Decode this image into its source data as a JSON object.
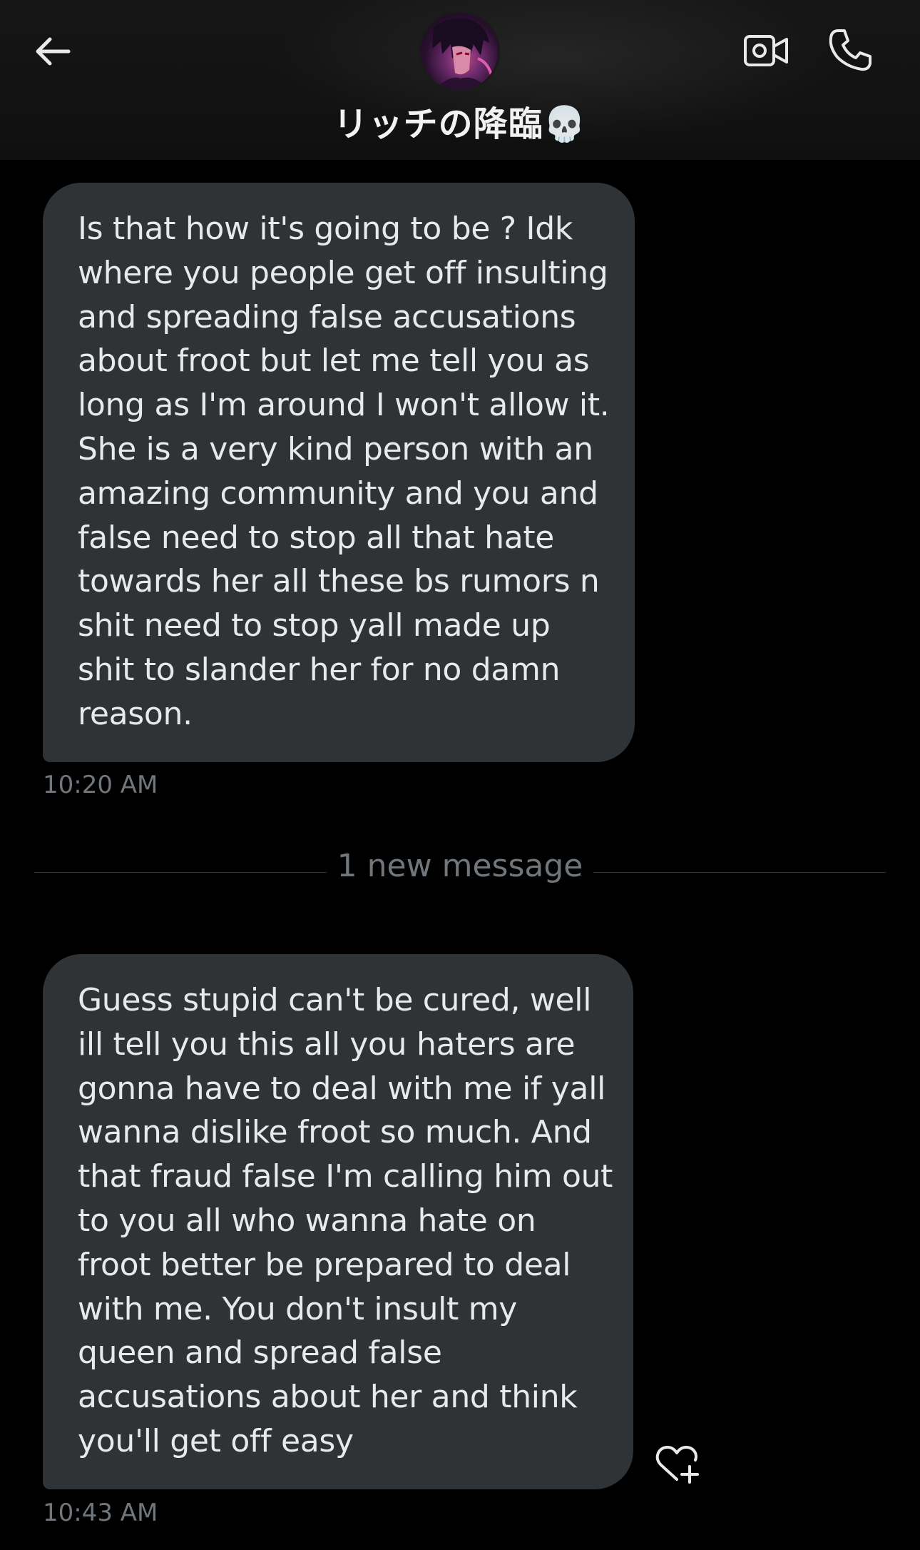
{
  "header": {
    "contact_name": "リッチの降臨💀",
    "back_icon": "arrow-left-icon",
    "video_icon": "video-camera-icon",
    "call_icon": "phone-icon"
  },
  "messages": [
    {
      "lines": [
        "Is that how it's going to be  ? Idk",
        "where you people get off insulting",
        "and spreading false accusations",
        "about froot but let me tell you as",
        "long as I'm around I won't allow it.",
        "She is a very kind person with an",
        "amazing community and you and",
        "false need to stop all that hate",
        "towards her all these bs rumors n",
        "shit need to stop yall made up",
        "shit to slander her for no damn",
        "reason."
      ],
      "timestamp": "10:20 AM"
    },
    {
      "lines": [
        "Guess stupid can't be cured, well",
        "ill tell you this all you haters are",
        "gonna have to deal with me if yall",
        "wanna dislike froot so much. And",
        "that fraud false I'm calling him out",
        "to you all who wanna hate on",
        "froot better be prepared to deal",
        "with me. You don't insult my",
        "queen and spread false",
        "accusations about her and think",
        "you'll get off easy"
      ],
      "timestamp": "10:43 AM"
    }
  ],
  "divider": {
    "label": "1 new message"
  },
  "colors": {
    "background": "#000000",
    "bubble": "#2f3336",
    "text": "#e7e9ea",
    "muted": "#71767b"
  }
}
